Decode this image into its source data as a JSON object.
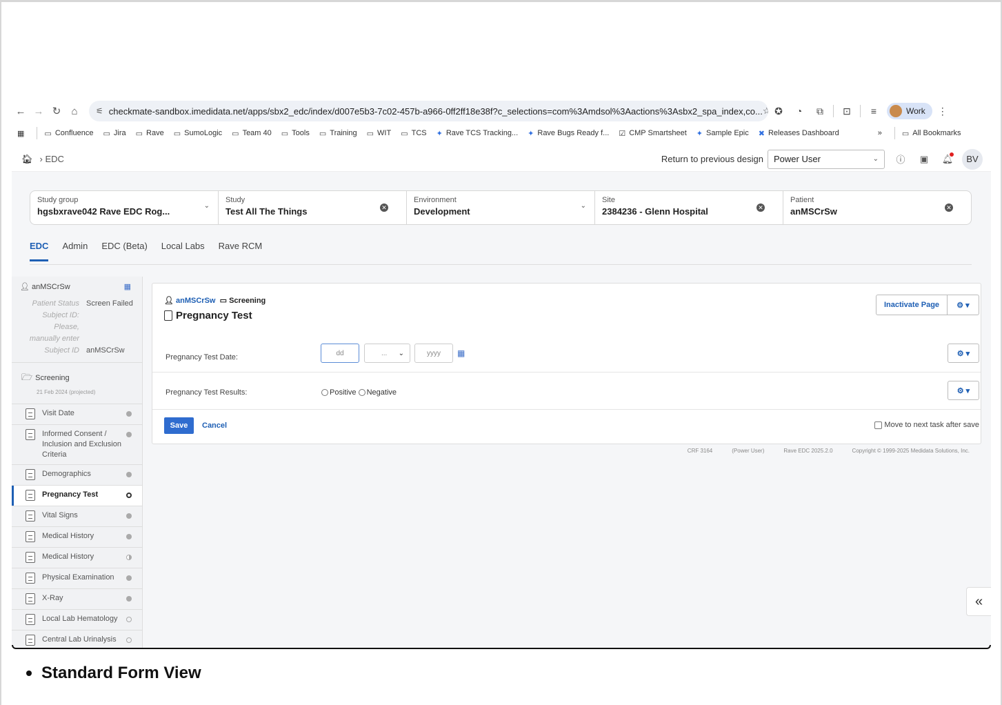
{
  "browser": {
    "url": "checkmate-sandbox.imedidata.net/apps/sbx2_edc/index/d007e5b3-7c02-457b-a966-0ff2ff18e38f?c_selections=com%3Amdsol%3Aactions%3Asbx2_spa_index,co...",
    "profile_label": "Work",
    "bookmarks": [
      "Confluence",
      "Jira",
      "Rave",
      "SumoLogic",
      "Team 40",
      "Tools",
      "Training",
      "WIT",
      "TCS",
      "Rave TCS Tracking...",
      "Rave Bugs Ready f...",
      "CMP Smartsheet",
      "Sample Epic",
      "Releases Dashboard"
    ],
    "bookmarks_more": "»",
    "all_bookmarks": "All Bookmarks"
  },
  "header": {
    "breadcrumb": "EDC",
    "return_link": "Return to previous design",
    "role_select": "Power User",
    "user_initials": "BV"
  },
  "selectors": [
    {
      "label": "Study group",
      "value": "hgsbxrave042 Rave EDC Rog..."
    },
    {
      "label": "Study",
      "value": "Test All The Things"
    },
    {
      "label": "Environment",
      "value": "Development"
    },
    {
      "label": "Site",
      "value": "2384236 - Glenn Hospital"
    },
    {
      "label": "Patient",
      "value": "anMSCrSw"
    }
  ],
  "tabs": [
    "EDC",
    "Admin",
    "EDC (Beta)",
    "Local Labs",
    "Rave RCM"
  ],
  "sidebar": {
    "patient": "anMSCrSw",
    "status_label": "Patient Status",
    "status_value": "Screen Failed",
    "subject_id_label": "Subject ID:",
    "subject_hint_1": "Please,",
    "subject_hint_2": "manually enter",
    "subject_id_label2": "Subject ID",
    "subject_id_value": "anMSCrSw",
    "folder": "Screening",
    "folder_date": "21 Feb 2024 (projected)",
    "forms": [
      {
        "name": "Visit Date"
      },
      {
        "name": "Informed Consent / Inclusion and Exclusion Criteria"
      },
      {
        "name": "Demographics"
      },
      {
        "name": "Pregnancy Test"
      },
      {
        "name": "Vital Signs"
      },
      {
        "name": "Medical History"
      },
      {
        "name": "Medical History"
      },
      {
        "name": "Physical Examination"
      },
      {
        "name": "X-Ray"
      },
      {
        "name": "Local Lab Hematology"
      },
      {
        "name": "Central Lab Urinalysis"
      }
    ]
  },
  "form": {
    "crumb_patient": "anMSCrSw",
    "crumb_folder": "Screening",
    "title": "Pregnancy Test",
    "inactivate": "Inactivate Page",
    "gear": "⚙ ▾",
    "field1_label": "Pregnancy Test Date:",
    "dd_placeholder": "dd",
    "mm_placeholder": "...",
    "yy_placeholder": "yyyy",
    "field2_label": "Pregnancy Test Results:",
    "opt_positive": "Positive",
    "opt_negative": "Negative",
    "save": "Save",
    "cancel": "Cancel",
    "move_next": "Move to next task after save"
  },
  "footer": [
    "CRF 3164",
    "(Power User)",
    "Rave EDC 2025.2.0",
    "Copyright © 1999-2025 Medidata Solutions, Inc."
  ],
  "caption": "Standard Form View"
}
